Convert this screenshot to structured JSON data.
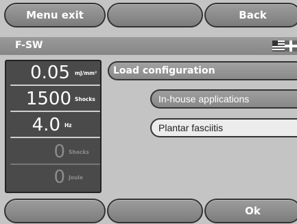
{
  "top_bar": {
    "menu_exit_label": "Menu exit",
    "middle_label": "",
    "back_label": "Back"
  },
  "header": {
    "title": "F-SW",
    "language_flag": "us-uk-flag-icon"
  },
  "parameters": [
    {
      "value": "0.05",
      "unit": "mJ/mm²"
    },
    {
      "value": "1500",
      "unit": "Shocks"
    },
    {
      "value": "4.0",
      "unit": "Hz"
    },
    {
      "value": "0",
      "unit": "Shocks"
    },
    {
      "value": "0",
      "unit": "Joule"
    }
  ],
  "menu": {
    "load_configuration": "Load configuration",
    "in_house_applications": "In-house applications",
    "plantar_fasciitis": "Plantar fasciitis"
  },
  "bottom_bar": {
    "left_label": "",
    "middle_label": "",
    "ok_label": "Ok"
  },
  "colors": {
    "background": "#c4c4c4",
    "button": "#8c8c8c",
    "panel": "#4a4a4a",
    "selected_item": "#ececec"
  }
}
